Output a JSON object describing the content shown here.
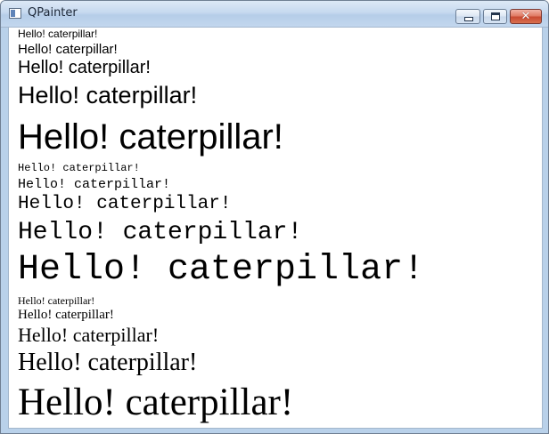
{
  "window": {
    "title": "QPainter",
    "buttons": {
      "minimize": "minimize",
      "maximize": "maximize",
      "close": "✕"
    }
  },
  "canvas": {
    "text": "Hello! caterpillar!",
    "groups": [
      {
        "family": "sans-serif",
        "lines": [
          "Hello! caterpillar!",
          "Hello! caterpillar!",
          "Hello! caterpillar!",
          "Hello! caterpillar!",
          "Hello! caterpillar!"
        ]
      },
      {
        "family": "monospace",
        "lines": [
          "Hello! caterpillar!",
          "Hello! caterpillar!",
          "Hello! caterpillar!",
          "Hello! caterpillar!",
          "Hello! caterpillar!"
        ]
      },
      {
        "family": "serif",
        "lines": [
          "Hello! caterpillar!",
          "Hello! caterpillar!",
          "Hello! caterpillar!",
          "Hello! caterpillar!",
          "Hello! caterpillar!"
        ]
      }
    ]
  }
}
